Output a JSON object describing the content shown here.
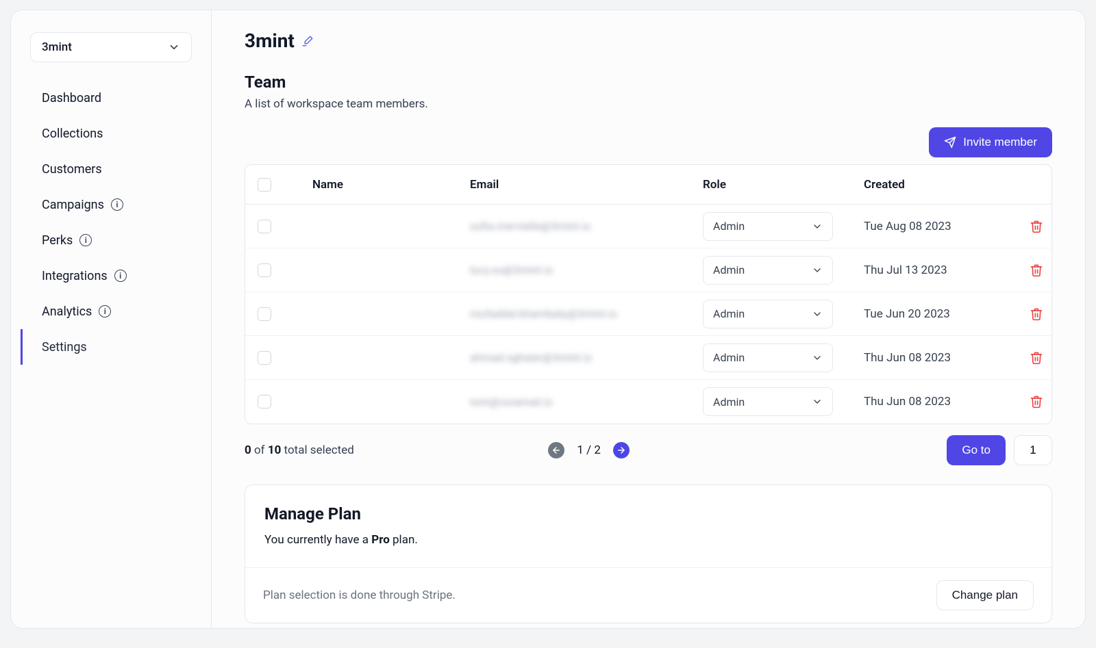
{
  "workspace": {
    "name": "3mint"
  },
  "sidebar": {
    "items": [
      {
        "label": "Dashboard",
        "info": false
      },
      {
        "label": "Collections",
        "info": false
      },
      {
        "label": "Customers",
        "info": false
      },
      {
        "label": "Campaigns",
        "info": true
      },
      {
        "label": "Perks",
        "info": true
      },
      {
        "label": "Integrations",
        "info": true
      },
      {
        "label": "Analytics",
        "info": true
      },
      {
        "label": "Settings",
        "info": false
      }
    ],
    "activeIndex": 7
  },
  "page": {
    "title": "3mint"
  },
  "team": {
    "heading": "Team",
    "subheading": "A list of workspace team members.",
    "inviteLabel": "Invite member",
    "columns": {
      "name": "Name",
      "email": "Email",
      "role": "Role",
      "created": "Created"
    },
    "rows": [
      {
        "name": "",
        "email": "sofia.mervielle@3mint.io",
        "role": "Admin",
        "created": "Tue Aug 08 2023"
      },
      {
        "name": "",
        "email": "lucy.xu@3mint.io",
        "role": "Admin",
        "created": "Thu Jul 13 2023"
      },
      {
        "name": "",
        "email": "mufaddal.khambaty@3mint.io",
        "role": "Admin",
        "created": "Tue Jun 20 2023"
      },
      {
        "name": "",
        "email": "ahmad.sghaier@3mint.io",
        "role": "Admin",
        "created": "Thu Jun 08 2023"
      },
      {
        "name": "",
        "email": "tom@voramail.io",
        "role": "Admin",
        "created": "Thu Jun 08 2023"
      }
    ]
  },
  "pagination": {
    "selected": "0",
    "of": " of ",
    "total": "10",
    "totalSuffix": " total selected",
    "page": "1 / 2",
    "gotoLabel": "Go to",
    "gotoValue": "1"
  },
  "plan": {
    "heading": "Manage Plan",
    "prefix": "You currently have a ",
    "name": "Pro",
    "suffix": " plan.",
    "footerText": "Plan selection is done through Stripe.",
    "changeLabel": "Change plan"
  }
}
